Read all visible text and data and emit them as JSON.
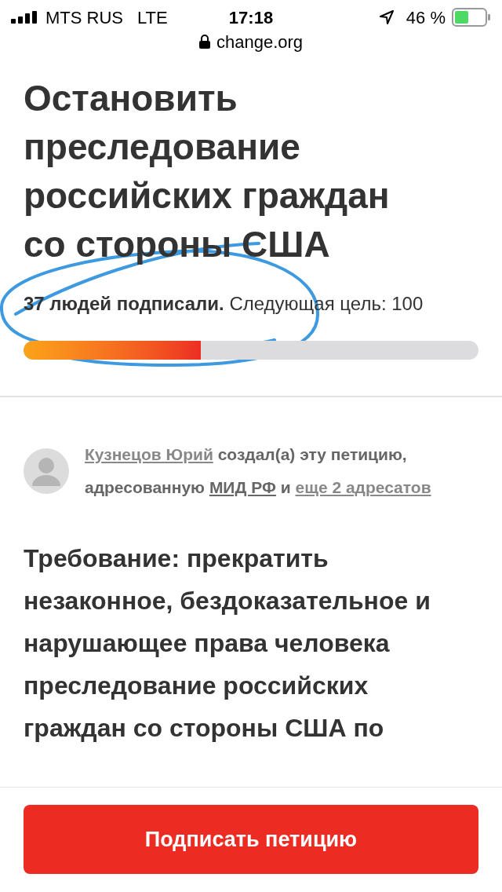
{
  "status_bar": {
    "carrier": "MTS RUS",
    "network": "LTE",
    "time": "17:18",
    "battery": "46 %"
  },
  "address_bar": {
    "url": "change.org"
  },
  "petition": {
    "title": "Остановить преследование российских граждан со стороны США",
    "signed": "**37 людей подписали.** Следующая цель: 100",
    "level": 0.39
  },
  "author": {
    "name": "Кузнецов Юрий",
    "text_1": " создал(а) эту петицию, адресованную ",
    "recipient": "МИД РФ",
    "text_2": " и ",
    "others": "еще 2 адресатов"
  },
  "body": "Требование: прекратить незаконное, бездоказательное и нарушающее права человека преследование российских граждан со стороны США по",
  "sign_button": "Подписать петицию"
}
